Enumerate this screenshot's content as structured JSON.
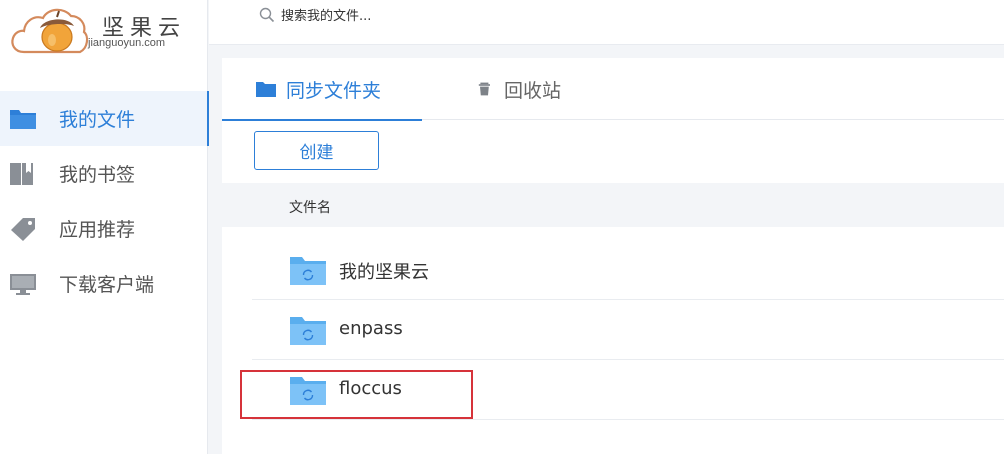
{
  "app": {
    "brand": "坚果云",
    "domain": "jianguoyun.com"
  },
  "search": {
    "placeholder": "搜索我的文件..."
  },
  "sidebar": {
    "items": [
      {
        "label": "我的文件",
        "icon": "folder-icon",
        "active": true
      },
      {
        "label": "我的书签",
        "icon": "bookmark-icon",
        "active": false
      },
      {
        "label": "应用推荐",
        "icon": "tag-icon",
        "active": false
      },
      {
        "label": "下载客户端",
        "icon": "monitor-icon",
        "active": false
      }
    ]
  },
  "tabs": [
    {
      "label": "同步文件夹",
      "icon": "folder-icon",
      "active": true
    },
    {
      "label": "回收站",
      "icon": "trash-icon",
      "active": false
    }
  ],
  "toolbar": {
    "create_label": "创建"
  },
  "table": {
    "column_name": "文件名",
    "rows": [
      {
        "name": "我的坚果云",
        "icon": "sync-folder-icon"
      },
      {
        "name": "enpass",
        "icon": "sync-folder-icon"
      },
      {
        "name": "floccus",
        "icon": "sync-folder-icon",
        "highlighted": true
      }
    ]
  },
  "colors": {
    "accent": "#2d7fd8",
    "folder": "#7dc2f7",
    "highlight": "#d6333a"
  }
}
